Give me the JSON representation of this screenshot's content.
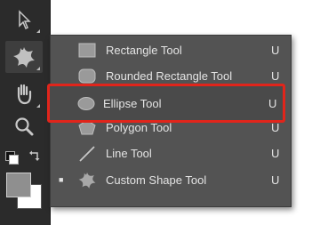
{
  "toolbar": {
    "tools": [
      {
        "name": "move-tool",
        "icon": "move-arrow-icon"
      },
      {
        "name": "custom-shape-tool",
        "icon": "custom-shape-icon"
      },
      {
        "name": "hand-tool",
        "icon": "hand-icon"
      },
      {
        "name": "zoom-tool",
        "icon": "magnifier-icon"
      }
    ],
    "foreground_color": "#8f8f8f",
    "background_color": "#ffffff"
  },
  "flyout": {
    "items": [
      {
        "label": "Rectangle Tool",
        "shortcut": "U",
        "icon": "rectangle-icon",
        "selected": false
      },
      {
        "label": "Rounded Rectangle Tool",
        "shortcut": "U",
        "icon": "rounded-rectangle-icon",
        "selected": false
      },
      {
        "label": "Ellipse Tool",
        "shortcut": "U",
        "icon": "ellipse-icon",
        "selected": false
      },
      {
        "label": "Polygon Tool",
        "shortcut": "U",
        "icon": "polygon-icon",
        "selected": false
      },
      {
        "label": "Line Tool",
        "shortcut": "U",
        "icon": "line-icon",
        "selected": false
      },
      {
        "label": "Custom Shape Tool",
        "shortcut": "U",
        "icon": "custom-shape-icon",
        "selected": true
      }
    ],
    "current_mark": "■"
  },
  "annotation": {
    "highlight_color": "#e1251b",
    "highlighted_item": "Ellipse Tool"
  }
}
